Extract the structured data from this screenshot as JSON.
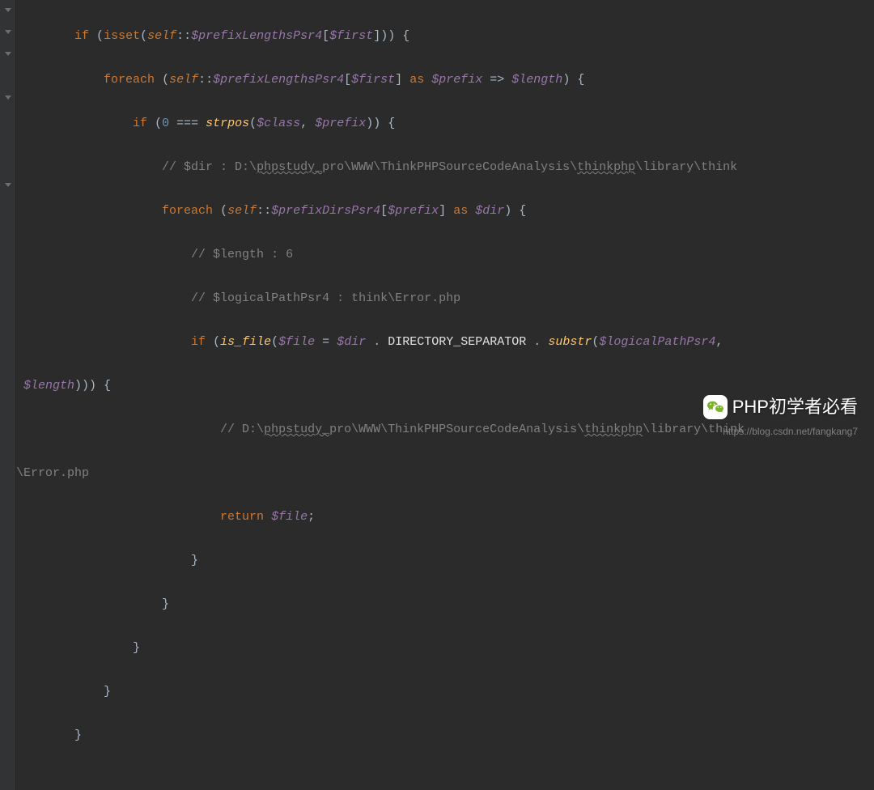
{
  "code": {
    "l1_kw_if": "if",
    "l1_fn_isset": "isset",
    "l1_self": "self",
    "l1_static1": "$prefixLengthsPsr4",
    "l1_var1": "$first",
    "l2_kw_foreach": "foreach",
    "l2_self": "self",
    "l2_static1": "$prefixLengthsPsr4",
    "l2_var1": "$first",
    "l2_kw_as": "as",
    "l2_var2": "$prefix",
    "l2_var3": "$length",
    "l3_kw_if": "if",
    "l3_num": "0",
    "l3_op": "===",
    "l3_fn": "strpos",
    "l3_var1": "$class",
    "l3_var2": "$prefix",
    "l4_comment_pre": "// $dir : D:\\",
    "l4_comment_u1": "phpstudy_",
    "l4_comment_mid1": "pro\\WWW\\ThinkPHPSourceCodeAnalysis\\",
    "l4_comment_u2": "thinkphp",
    "l4_comment_end": "\\library\\think",
    "l5_kw_foreach": "foreach",
    "l5_self": "self",
    "l5_static1": "$prefixDirsPsr4",
    "l5_var1": "$prefix",
    "l5_kw_as": "as",
    "l5_var2": "$dir",
    "l6_comment": "// $length : 6",
    "l7_comment": "// $logicalPathPsr4 : think\\Error.php",
    "l8_kw_if": "if",
    "l8_fn1": "is_file",
    "l8_var1": "$file",
    "l8_var2": "$dir",
    "l8_const": "DIRECTORY_SEPARATOR",
    "l8_fn2": "substr",
    "l8_var3": "$logicalPathPsr4",
    "l9_var1": "$length",
    "l10_comment_pre": "// D:\\",
    "l10_comment_u1": "phpstudy_",
    "l10_comment_mid1": "pro\\WWW\\ThinkPHPSourceCodeAnalysis\\",
    "l10_comment_u2": "thinkphp",
    "l10_comment_end": "\\library\\think",
    "l11_comment": "\\Error.php",
    "l12_kw_return": "return",
    "l12_var1": "$file",
    "close_brace": "}"
  },
  "watermark": {
    "text": "PHP初学者必看",
    "url": "https://blog.csdn.net/fangkang7"
  }
}
